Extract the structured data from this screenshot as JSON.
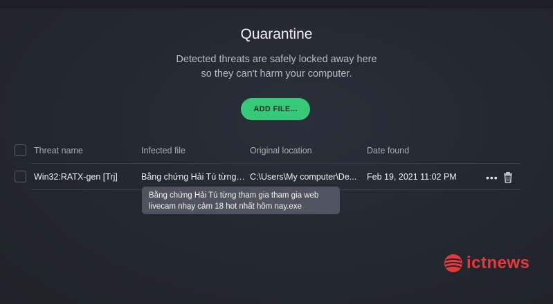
{
  "page": {
    "title": "Quarantine",
    "subtitle_line1": "Detected threats are safely locked away here",
    "subtitle_line2": "so they can't harm your computer.",
    "add_button": "ADD FILE..."
  },
  "table": {
    "headers": [
      "Threat name",
      "Infected file",
      "Original location",
      "Date found"
    ],
    "rows": [
      {
        "threat_name": "Win32:RATX-gen [Trj]",
        "infected_file": "Bằng chứng Hải Tú từng ...",
        "original_location": "C:\\Users\\My computer\\De...",
        "date_found": "Feb 19, 2021 11:02 PM"
      }
    ],
    "row_actions": {
      "more": "•••"
    }
  },
  "tooltip": {
    "line1": "Bằng chứng Hải Tú từng tham gia tham gia web",
    "line2": "livecam nhạy cảm 18 hot nhất hôm nay.exe"
  },
  "watermark": {
    "text": "ictnews",
    "color": "#e63a3a"
  },
  "colors": {
    "accent": "#38c978",
    "background": "#23272f"
  }
}
